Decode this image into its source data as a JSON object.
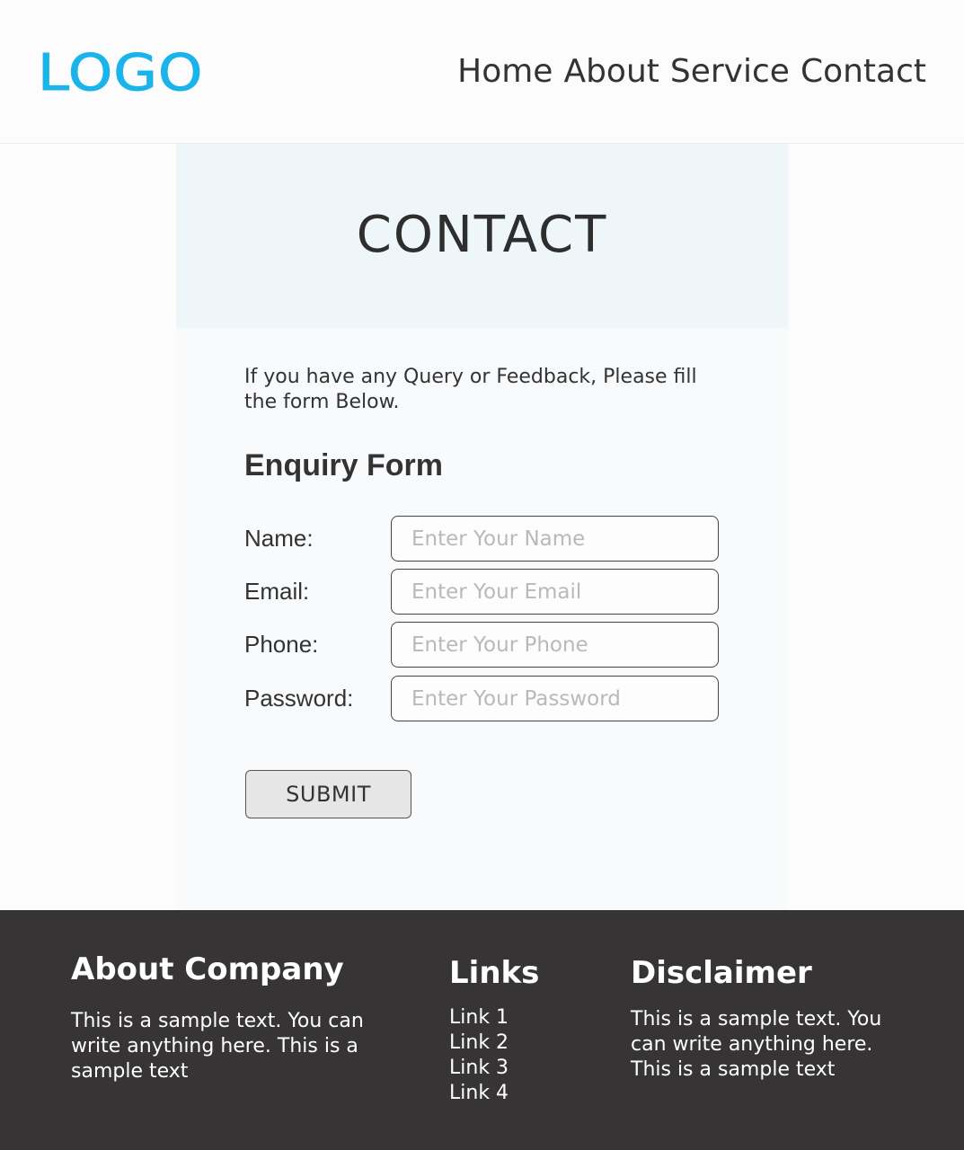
{
  "header": {
    "logo": "LOGO",
    "nav": [
      "Home",
      "About",
      "Service",
      "Contact"
    ]
  },
  "banner": {
    "title": "CONTACT"
  },
  "intro": "If you have any Query or Feedback, Please fill the form Below.",
  "form": {
    "title": "Enquiry Form",
    "fields": [
      {
        "label": "Name:",
        "placeholder": "Enter Your Name",
        "value": ""
      },
      {
        "label": "Email:",
        "placeholder": "Enter Your Email",
        "value": ""
      },
      {
        "label": "Phone:",
        "placeholder": "Enter Your Phone",
        "value": ""
      },
      {
        "label": "Password:",
        "placeholder": "Enter Your Password",
        "value": ""
      }
    ],
    "submit_label": "SUBMIT"
  },
  "footer": {
    "about": {
      "title": "About Company",
      "text": "This is a sample text. You can write anything here. This is a sample text"
    },
    "links": {
      "title": "Links",
      "items": [
        "Link 1",
        "Link 2",
        "Link 3",
        "Link 4"
      ]
    },
    "disclaimer": {
      "title": "Disclaimer",
      "text": "This is a sample text. You can write anything here. This is a sample text"
    }
  },
  "colors": {
    "logo": "#1ab4ea",
    "banner_bg": "#eef6fa",
    "footer_bg": "#363435",
    "button_bg": "#e6e6e6"
  }
}
